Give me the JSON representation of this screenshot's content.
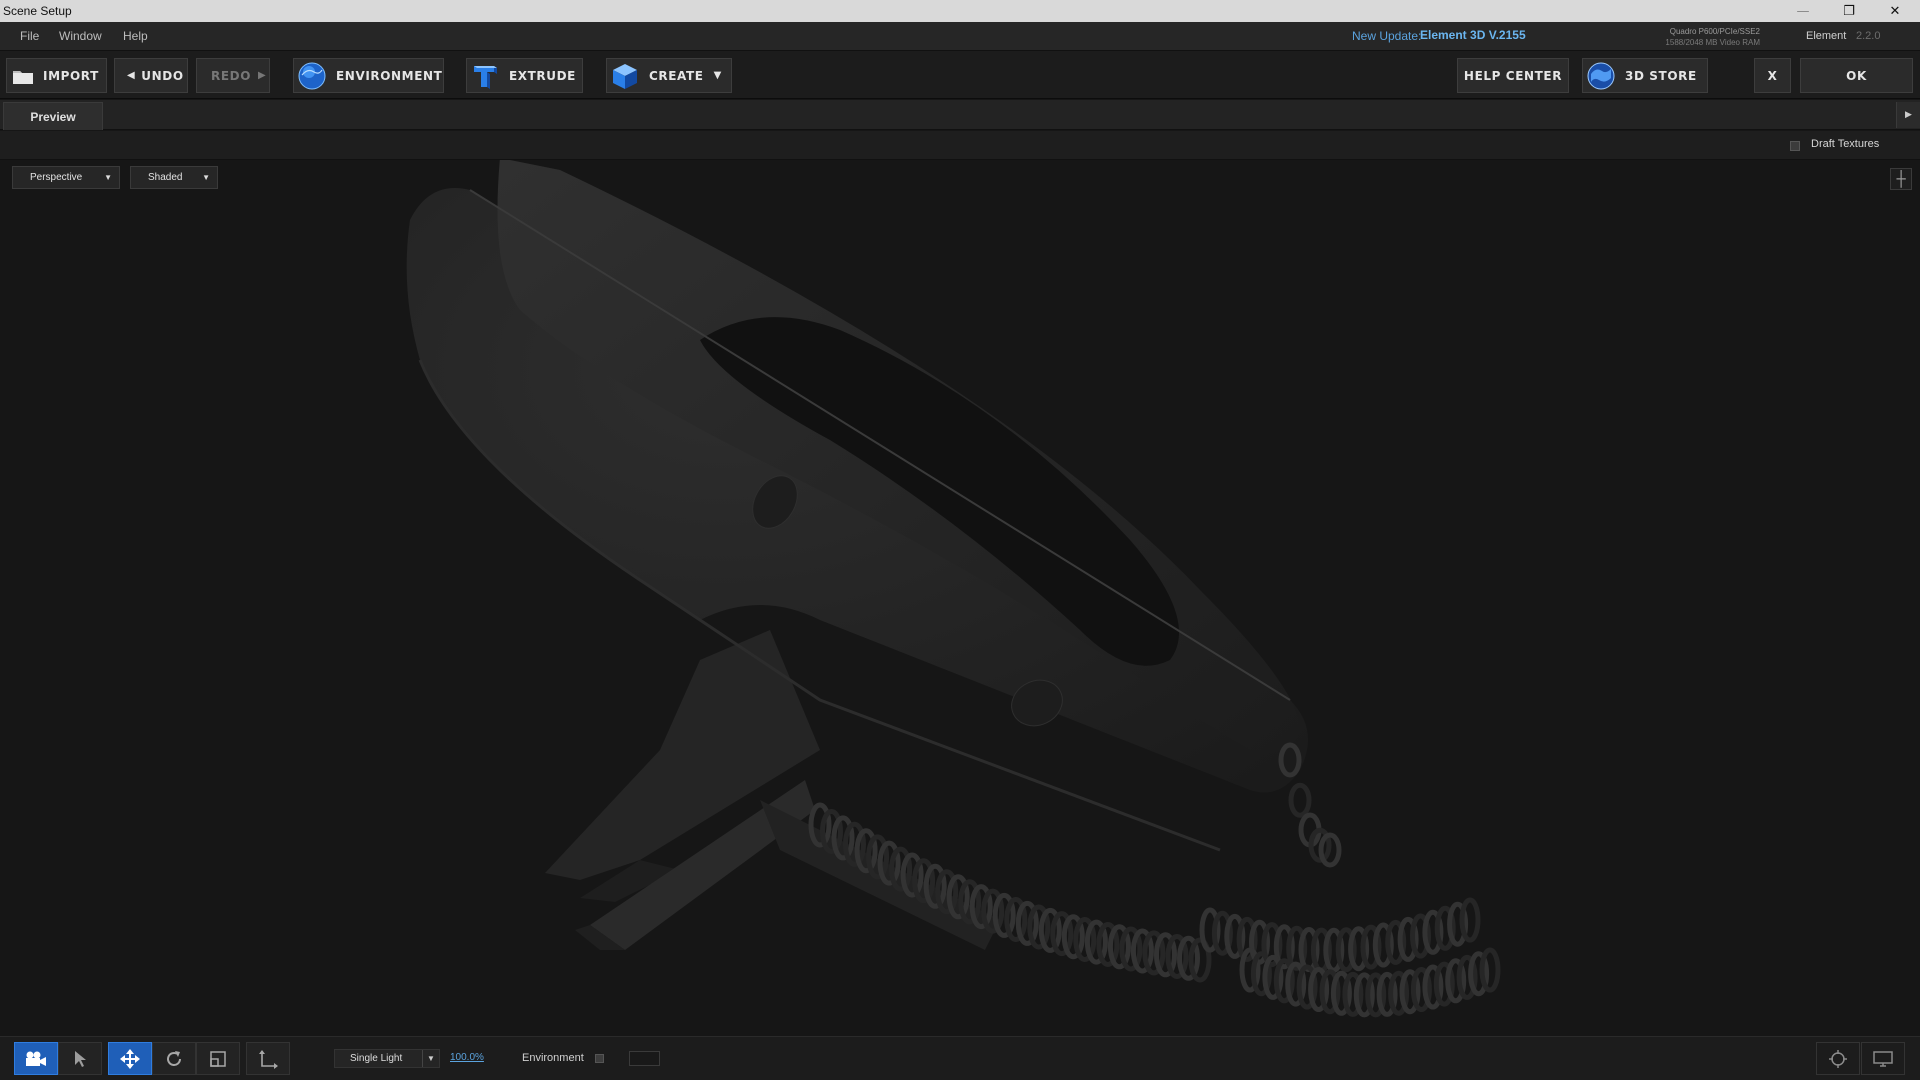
{
  "window": {
    "title": "Scene Setup",
    "controls": {
      "minimize": "—",
      "restore": "❐",
      "close": "✕"
    }
  },
  "menu": {
    "items": [
      "File",
      "Window",
      "Help"
    ]
  },
  "update": {
    "label": "New Update:",
    "version": "Element 3D V.2155"
  },
  "gpu": {
    "name": "Quadro P600/PCIe/SSE2",
    "ram": "1588/2048 MB Video RAM"
  },
  "app": {
    "name": "Element",
    "version": "2.2.0"
  },
  "toolbar": {
    "import": "IMPORT",
    "undo": "UNDO",
    "redo": "REDO",
    "environment": "ENVIRONMENT",
    "extrude": "EXTRUDE",
    "create": "CREATE",
    "help_center": "HELP CENTER",
    "store": "3D STORE",
    "close": "X",
    "ok": "OK"
  },
  "tabs": {
    "preview": "Preview"
  },
  "options": {
    "draft_textures": "Draft Textures",
    "draft_textures_checked": false
  },
  "viewport": {
    "camera": "Perspective",
    "shading": "Shaded"
  },
  "bottom": {
    "lighting": "Single Light",
    "lighting_intensity": "100.0%",
    "environment_label": "Environment",
    "environment_checked": false,
    "tools": [
      {
        "name": "camera-tool",
        "icon": "camera-icon",
        "active": true
      },
      {
        "name": "select-tool",
        "icon": "pointer-icon",
        "active": false
      },
      {
        "name": "move-tool",
        "icon": "move-icon",
        "active": true
      },
      {
        "name": "rotate-tool",
        "icon": "rotate-icon",
        "active": false
      },
      {
        "name": "scale-tool",
        "icon": "scale-icon",
        "active": false
      },
      {
        "name": "world-axis-tool",
        "icon": "axis-icon",
        "active": false
      }
    ]
  },
  "colors": {
    "accent_blue": "#1f5fb8",
    "link_blue": "#5ba3de",
    "background": "#161616",
    "toolbar": "#1c1c1c"
  }
}
